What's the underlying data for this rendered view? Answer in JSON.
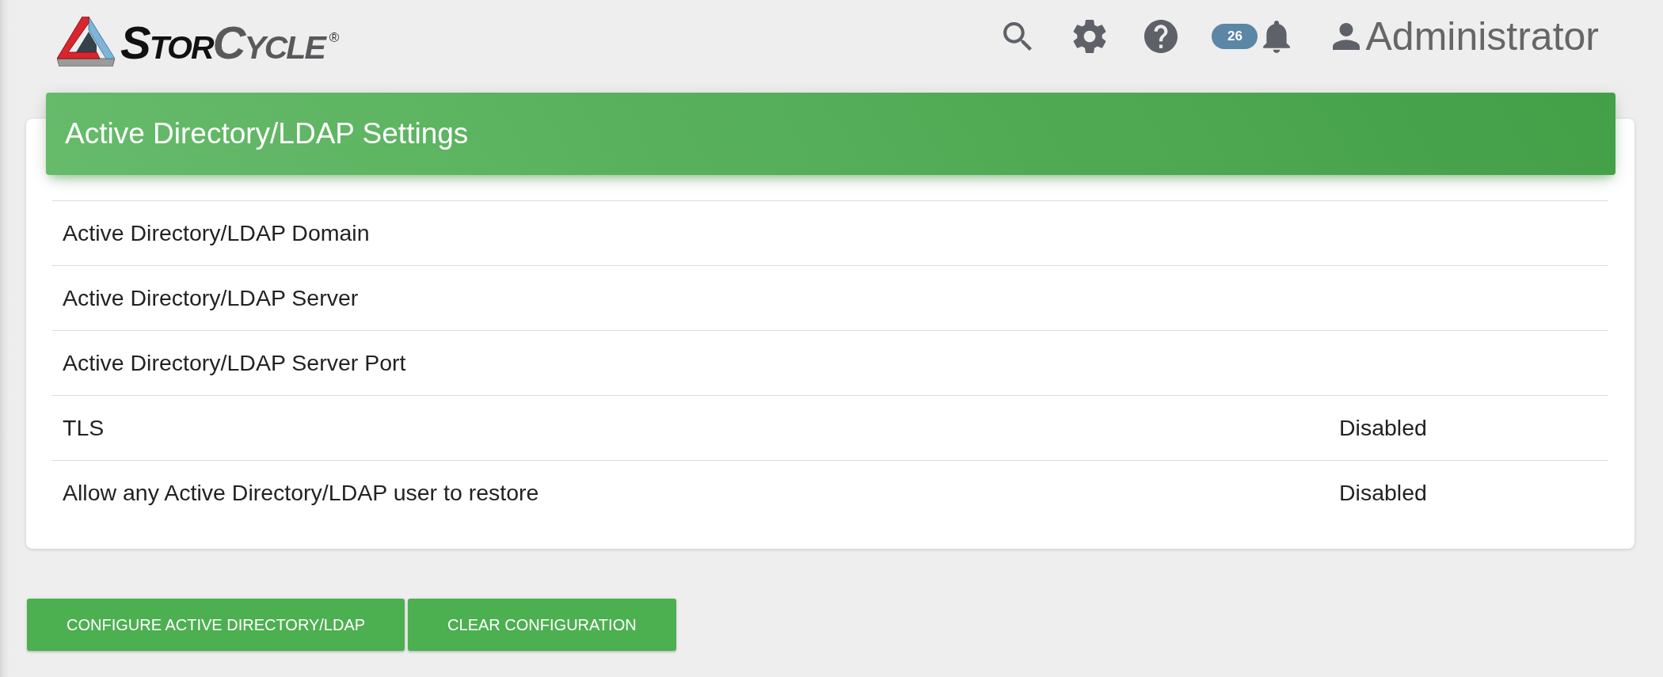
{
  "header": {
    "logo": {
      "part_1": "Stor",
      "part_2": "Cycle",
      "registered_mark": "®"
    },
    "notifications": {
      "count": "26"
    },
    "user": {
      "name": "Administrator"
    }
  },
  "settings_card": {
    "title": "Active Directory/LDAP Settings",
    "rows": [
      {
        "label": "Active Directory/LDAP Domain"
      },
      {
        "label": "Active Directory/LDAP Server"
      },
      {
        "label": "Active Directory/LDAP Server Port"
      },
      {
        "label": "TLS",
        "value": "Disabled"
      },
      {
        "label": "Allow any Active Directory/LDAP user to restore",
        "value": "Disabled"
      }
    ]
  },
  "buttons": [
    {
      "label": "CONFIGURE ACTIVE DIRECTORY/LDAP"
    },
    {
      "label": "CLEAR CONFIGURATION"
    }
  ]
}
